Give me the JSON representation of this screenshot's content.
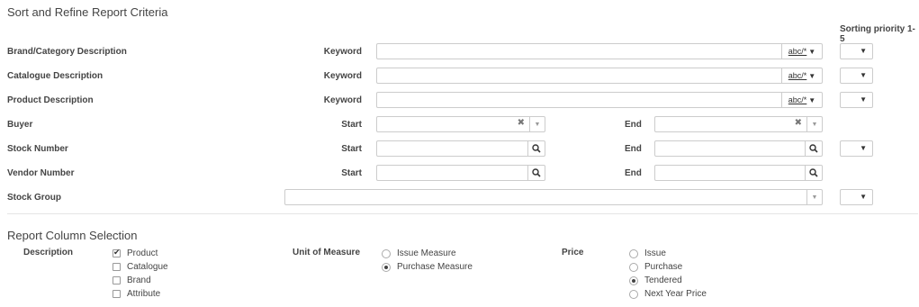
{
  "criteria": {
    "title": "Sort and Refine Report Criteria",
    "sorting_label": "Sorting priority 1-5",
    "keyword_label": "Keyword",
    "start_label": "Start",
    "end_label": "End",
    "kw_option": "abc/*",
    "rows": {
      "brand": "Brand/Category Description",
      "catalogue": "Catalogue Description",
      "product": "Product Description",
      "buyer": "Buyer",
      "stock_number": "Stock Number",
      "vendor_number": "Vendor Number",
      "stock_group": "Stock Group"
    }
  },
  "columns": {
    "title": "Report Column Selection",
    "description_label": "Description",
    "description_options": [
      {
        "label": "Product",
        "checked": true
      },
      {
        "label": "Catalogue",
        "checked": false
      },
      {
        "label": "Brand",
        "checked": false
      },
      {
        "label": "Attribute",
        "checked": false
      }
    ],
    "uom_label": "Unit of Measure",
    "uom_options": [
      {
        "label": "Issue Measure",
        "selected": false
      },
      {
        "label": "Purchase Measure",
        "selected": true
      }
    ],
    "price_label": "Price",
    "price_options": [
      {
        "label": "Issue",
        "selected": false
      },
      {
        "label": "Purchase",
        "selected": false
      },
      {
        "label": "Tendered",
        "selected": true
      },
      {
        "label": "Next Year Price",
        "selected": false
      }
    ]
  }
}
